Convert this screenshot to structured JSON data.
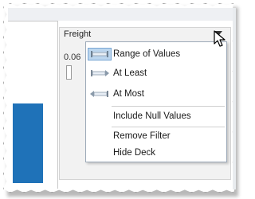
{
  "filter_card": {
    "title": "Freight",
    "range_value": "0.06"
  },
  "menu": {
    "items": [
      {
        "label": "Range of Values",
        "icon": "range-icon",
        "selected": true
      },
      {
        "label": "At Least",
        "icon": "at-least-icon",
        "selected": false
      },
      {
        "label": "At Most",
        "icon": "at-most-icon",
        "selected": false
      },
      {
        "label": "Include Null Values",
        "selected": false
      },
      {
        "label": "Remove Filter",
        "selected": false
      },
      {
        "label": "Hide Deck",
        "selected": false
      }
    ]
  },
  "colors": {
    "accent_bar": "#1f72b8",
    "selection": "#bcd6ee",
    "menu_border": "#9ca9b8"
  }
}
